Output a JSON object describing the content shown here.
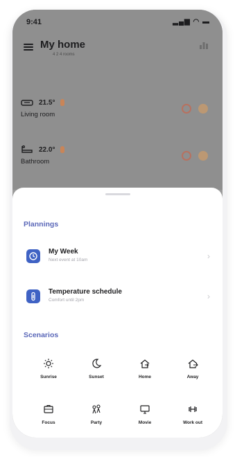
{
  "status": {
    "time": "9:41",
    "icons": "signal wifi battery"
  },
  "header": {
    "title": "My home",
    "subtitle": "4 2 4 rooms"
  },
  "rooms": [
    {
      "name": "Living room",
      "temperature": "21.5°"
    },
    {
      "name": "Bathroom",
      "temperature": "22.0°"
    }
  ],
  "sheet": {
    "plannings_title": "Plannings",
    "plannings": [
      {
        "title": "My Week",
        "subtitle": "Next event at 10am"
      },
      {
        "title": "Temperature schedule",
        "subtitle": "Comfort until 2pm"
      }
    ],
    "scenarios_title": "Scenarios",
    "scenarios": [
      {
        "label": "Sunrise",
        "icon": "sunrise-icon"
      },
      {
        "label": "Sunset",
        "icon": "sunset-icon"
      },
      {
        "label": "Home",
        "icon": "home-icon"
      },
      {
        "label": "Away",
        "icon": "away-icon"
      },
      {
        "label": "Focus",
        "icon": "focus-icon"
      },
      {
        "label": "Party",
        "icon": "party-icon"
      },
      {
        "label": "Movie",
        "icon": "movie-icon"
      },
      {
        "label": "Work out",
        "icon": "workout-icon"
      }
    ]
  },
  "colors": {
    "accent": "#5a67b8",
    "plan_icon": "#3f62c4"
  }
}
